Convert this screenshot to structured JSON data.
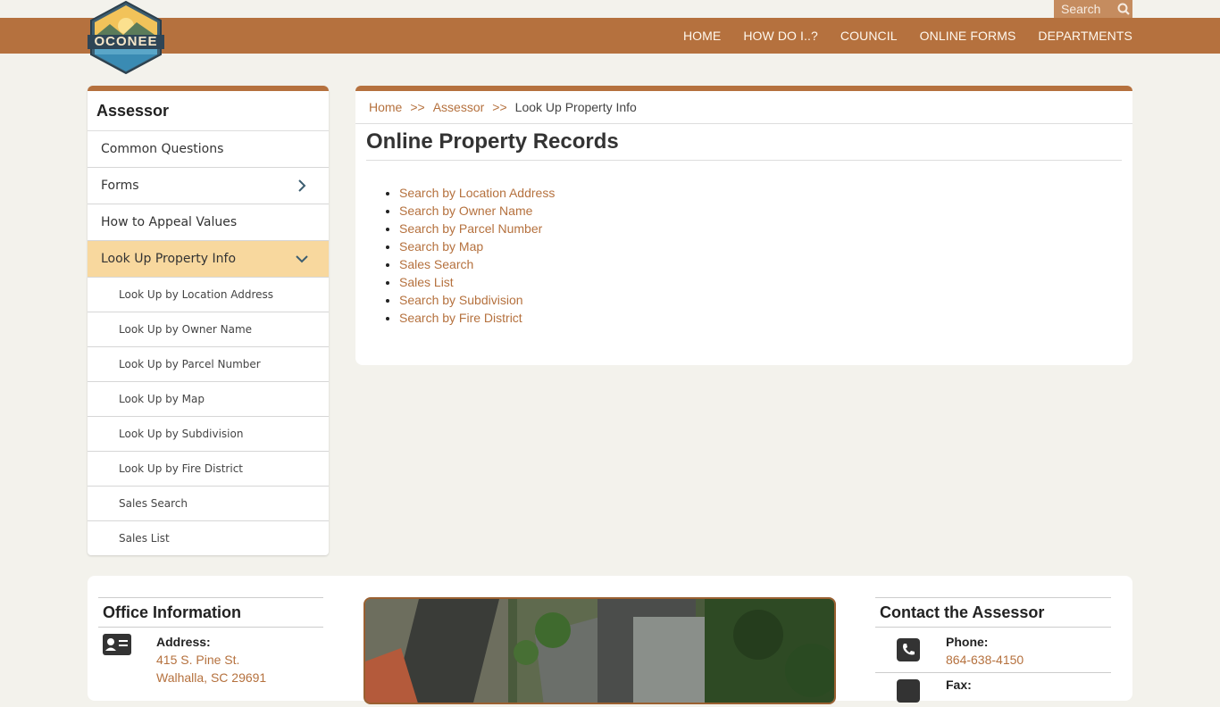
{
  "header": {
    "logo_text": "OCONEE",
    "search_label": "Search",
    "nav": [
      "HOME",
      "HOW DO I..?",
      "COUNCIL",
      "ONLINE FORMS",
      "DEPARTMENTS"
    ]
  },
  "sidebar": {
    "title": "Assessor",
    "items": [
      {
        "label": "Common Questions"
      },
      {
        "label": "Forms"
      },
      {
        "label": "How to Appeal Values"
      },
      {
        "label": "Look Up Property Info"
      }
    ],
    "subitems": [
      "Look Up by Location Address",
      "Look Up by Owner Name",
      "Look Up by Parcel Number",
      "Look Up by Map",
      "Look Up by Subdivision",
      "Look Up by Fire District",
      "Sales Search",
      "Sales List"
    ]
  },
  "breadcrumb": {
    "home": "Home",
    "sep": ">>",
    "section": "Assessor",
    "current": "Look Up Property Info"
  },
  "main": {
    "title": "Online Property Records",
    "links": [
      "Search by Location Address",
      "Search by Owner Name",
      "Search by Parcel Number",
      "Search by Map",
      "Sales Search",
      "Sales List",
      "Search by Subdivision",
      "Search by Fire District"
    ]
  },
  "office": {
    "title": "Office Information",
    "address_label": "Address:",
    "address_line1": "415 S. Pine St.",
    "address_line2": "Walhalla, SC 29691"
  },
  "contact": {
    "title": "Contact the Assessor",
    "phone_label": "Phone:",
    "phone": "864-638-4150",
    "fax_label": "Fax:"
  },
  "colors": {
    "brand": "#b5713e",
    "active": "#f8d89e",
    "background": "#f3f2ec"
  }
}
